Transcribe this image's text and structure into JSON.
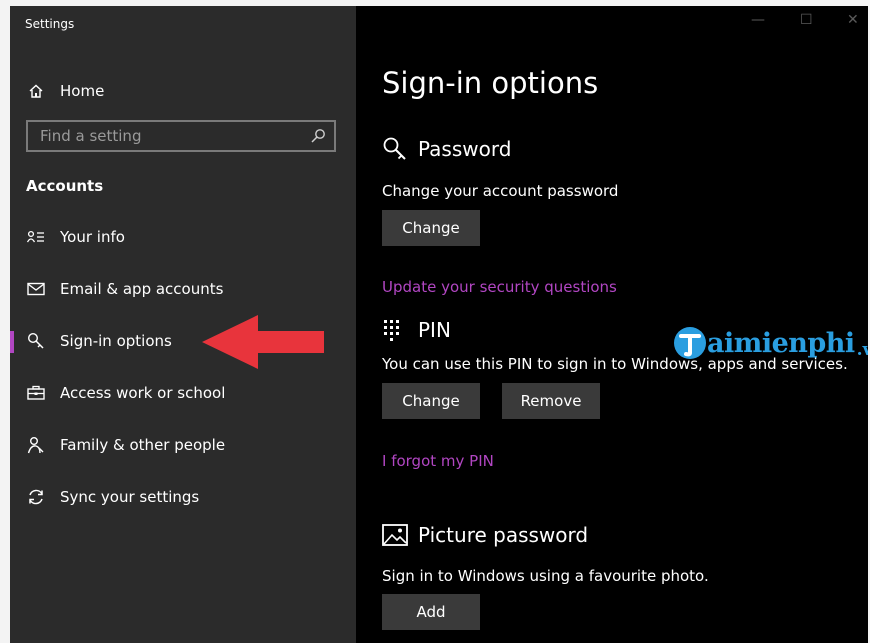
{
  "window": {
    "title": "Settings",
    "controls": {
      "minimize": "—",
      "maximize": "☐",
      "close": "✕"
    }
  },
  "sidebar": {
    "home_label": "Home",
    "search_placeholder": "Find a setting",
    "section_heading": "Accounts",
    "items": [
      {
        "label": "Your info",
        "icon": "person-lines-icon"
      },
      {
        "label": "Email & app accounts",
        "icon": "envelope-icon"
      },
      {
        "label": "Sign-in options",
        "icon": "key-icon",
        "selected": true
      },
      {
        "label": "Access work or school",
        "icon": "briefcase-icon"
      },
      {
        "label": "Family & other people",
        "icon": "people-icon"
      },
      {
        "label": "Sync your settings",
        "icon": "sync-icon"
      }
    ]
  },
  "main": {
    "title": "Sign-in options",
    "password": {
      "heading": "Password",
      "description": "Change your account password",
      "change_button": "Change",
      "security_link": "Update your security questions"
    },
    "pin": {
      "heading": "PIN",
      "description": "You can use this PIN to sign in to Windows, apps and services.",
      "change_button": "Change",
      "remove_button": "Remove",
      "forgot_link": "I forgot my PIN"
    },
    "picture_password": {
      "heading": "Picture password",
      "description": "Sign in to Windows using a favourite photo.",
      "add_button": "Add"
    }
  },
  "watermark": {
    "text": "aimienphi",
    "suffix": ".vn"
  },
  "colors": {
    "sidebar_bg": "#2b2b2b",
    "main_bg": "#000000",
    "accent": "#b146c2",
    "button_bg": "#3a3a3a",
    "annotation_arrow": "#e8343c",
    "watermark": "#2a9ee0"
  }
}
